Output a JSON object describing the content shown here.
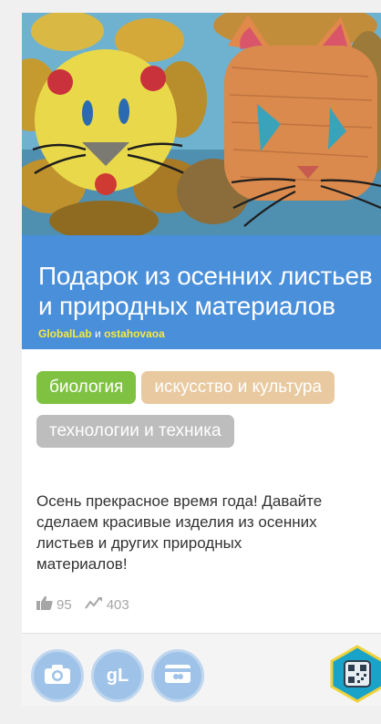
{
  "project": {
    "title_lines": [
      "Подарок из осенних листьев",
      "и природных материалов"
    ],
    "authors": [
      "GlobalLab",
      "ostahovaoa"
    ],
    "authors_joiner": "и",
    "tags": [
      "биология",
      "искусство и культура",
      "технологии и техника"
    ],
    "description_lines": [
      "Осень прекрасное время года! Давайте",
      "сделаем красивые изделия из осенних",
      "листьев и других природных",
      "материалов!"
    ],
    "stats": {
      "likes": "95",
      "views": "403"
    }
  },
  "footer": {
    "buttons": [
      "camera-icon",
      "globallab-logo-icon",
      "card-icon"
    ],
    "gl_logo_text": "gL",
    "badge_icon": "qr-code-icon"
  },
  "colors": {
    "title_band": "#4a8fd9",
    "author_link": "#f5ea3c",
    "tag_biology": "#7fc242",
    "tag_art": "#e8c9a0",
    "tag_tech": "#bdbdbd",
    "footer_button": "#9fc3e8",
    "badge": "#1aa3c8"
  }
}
